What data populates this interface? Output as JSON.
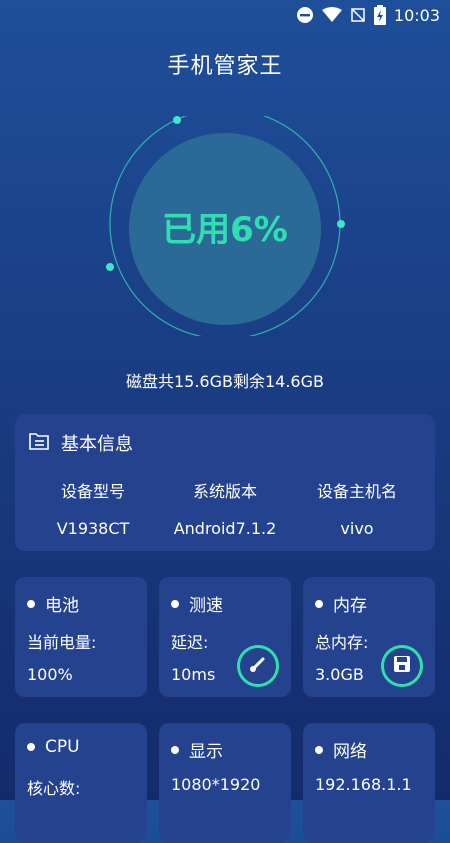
{
  "status_bar": {
    "time": "10:03",
    "icons": [
      "do-not-disturb-icon",
      "wifi-icon",
      "no-signal-icon",
      "battery-charging-icon"
    ]
  },
  "app": {
    "title": "手机管家王"
  },
  "gauge": {
    "label": "已用6%",
    "used_percent": 6,
    "accent": "#2ee0b1"
  },
  "disk_info": "磁盘共15.6GB剩余14.6GB",
  "basic_info": {
    "title": "基本信息",
    "icon": "file-list-icon",
    "columns": [
      {
        "label": "设备型号",
        "value": "V1938CT"
      },
      {
        "label": "系统版本",
        "value": "Android7.1.2"
      },
      {
        "label": "设备主机名",
        "value": "vivo"
      }
    ]
  },
  "cards": [
    {
      "title": "电池",
      "label": "当前电量:",
      "value": "100%"
    },
    {
      "title": "测速",
      "label": "延迟:",
      "value": "10ms",
      "icon": "speedometer-icon"
    },
    {
      "title": "内存",
      "label": "总内存:",
      "value": "3.0GB",
      "icon": "floppy-disk-icon"
    },
    {
      "title": "CPU",
      "label": "核心数:",
      "value": ""
    },
    {
      "title": "显示",
      "label": "1080*1920",
      "value": ""
    },
    {
      "title": "网络",
      "label": "192.168.1.1",
      "value": ""
    }
  ],
  "colors": {
    "background_top": "#1f4f9a",
    "background_bottom": "#142b6b",
    "card": "#25428f",
    "accent": "#2ee0a8"
  }
}
